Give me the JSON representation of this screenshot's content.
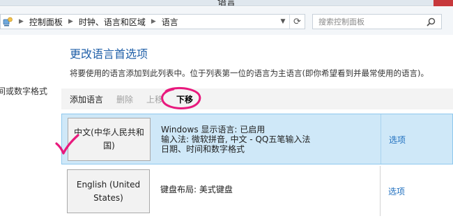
{
  "window": {
    "title": "语言"
  },
  "address": {
    "crumbs": [
      "控制面板",
      "时钟、语言和区域",
      "语言"
    ]
  },
  "search": {
    "placeholder": "搜索控制面板"
  },
  "leftnav": {
    "item": "间或数字格式"
  },
  "main": {
    "heading": "更改语言首选项",
    "description": "将要使用的语言添加到此列表中。位于列表第一位的语言为主语言(即你希望看到并最常使用的语言)。",
    "toolbar": {
      "add": "添加语言",
      "remove": "删除",
      "up": "上移",
      "down": "下移"
    },
    "languages": [
      {
        "name": "中文(中华人民共和国)",
        "info": [
          "Windows 显示语言: 已启用",
          "输入法: 微软拼音, 中文 - QQ五笔输入法",
          "日期、时间和数字格式"
        ],
        "options": "选项"
      },
      {
        "name": "English (United States)",
        "info": [
          "键盘布局: 美式键盘"
        ],
        "options": "选项"
      }
    ]
  },
  "colors": {
    "accent": "#1f5fa8",
    "selection": "#cfe8f8",
    "annotation": "#e8197d"
  }
}
